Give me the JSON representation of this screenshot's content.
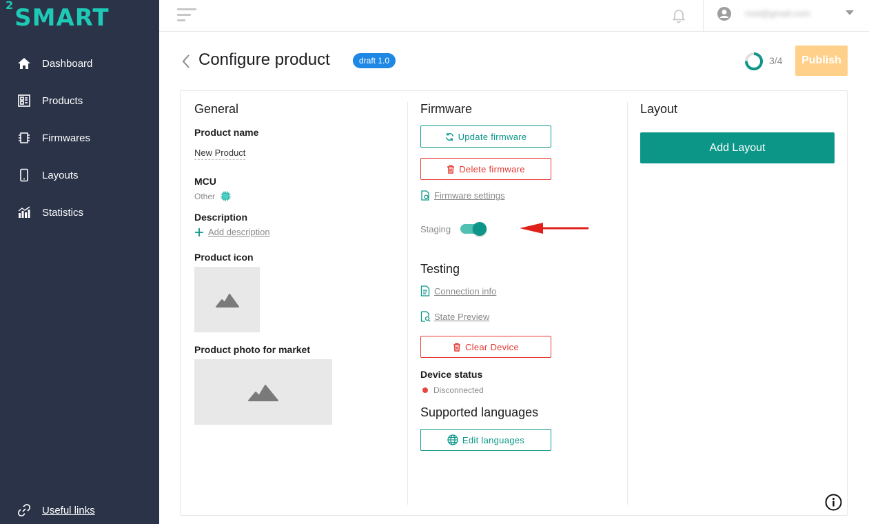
{
  "sidebar": {
    "logo_sup": "2",
    "logo_text": "SMART",
    "items": [
      {
        "label": "Dashboard",
        "icon": "home-icon"
      },
      {
        "label": "Products",
        "icon": "products-icon"
      },
      {
        "label": "Firmwares",
        "icon": "chip-icon"
      },
      {
        "label": "Layouts",
        "icon": "phone-icon"
      },
      {
        "label": "Statistics",
        "icon": "statistics-icon"
      }
    ],
    "useful_links": "Useful links"
  },
  "topbar": {
    "user_email": "root@gmail.com"
  },
  "header": {
    "title": "Configure product",
    "badge": "draft 1.0",
    "progress_text": "3/4",
    "progress_value": 0.75,
    "publish_label": "Publish"
  },
  "general": {
    "title": "General",
    "product_name_label": "Product name",
    "product_name_value": "New Product",
    "mcu_label": "MCU",
    "mcu_value": "Other",
    "description_label": "Description",
    "add_description": "Add description",
    "product_icon_label": "Product icon",
    "product_photo_label": "Product photo for market"
  },
  "firmware": {
    "title": "Firmware",
    "update_label": "Update firmware",
    "delete_label": "Delete firmware",
    "settings_label": "Firmware settings",
    "staging_label": "Staging",
    "staging_on": true
  },
  "testing": {
    "title": "Testing",
    "connection_info": "Connection info",
    "state_preview": "State Preview",
    "clear_device": "Clear Device",
    "device_status_label": "Device status",
    "device_status_value": "Disconnected"
  },
  "languages": {
    "title": "Supported languages",
    "edit_label": "Edit languages"
  },
  "layout": {
    "title": "Layout",
    "add_label": "Add Layout"
  },
  "colors": {
    "sidebar_bg": "#2a3348",
    "accent": "#0b9688",
    "danger": "#e5372f",
    "badge": "#1e88e5",
    "publish_disabled": "#ffd08a",
    "annotation_arrow": "#e0201b"
  }
}
